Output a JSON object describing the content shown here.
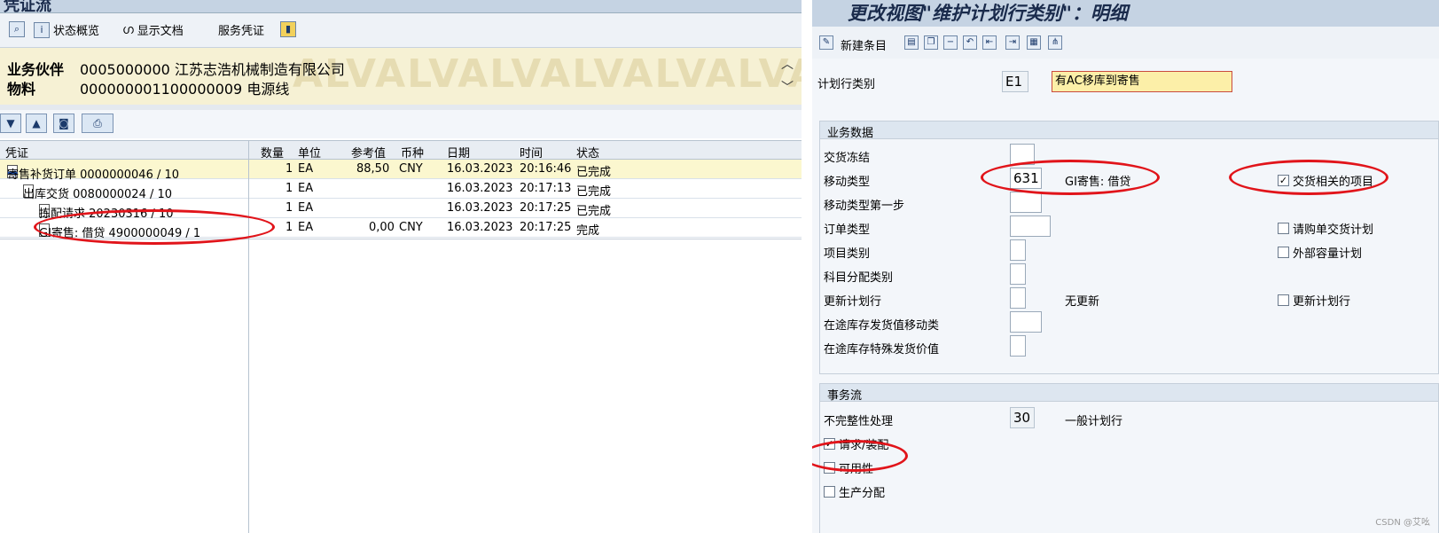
{
  "left": {
    "title": "凭证流",
    "toolbar": {
      "status_overview": "状态概览",
      "display_doc": "显示文档",
      "service_doc": "服务凭证"
    },
    "header": {
      "partner_label": "业务伙伴",
      "partner_value": "0005000000 江苏志浩机械制造有限公司",
      "material_label": "物料",
      "material_value": "000000001100000009 电源线"
    },
    "watermark": "ALVALVALVALVALVALVALV",
    "columns": [
      "凭证",
      "数量",
      "单位",
      "参考值",
      "币种",
      "日期",
      "时间",
      "状态"
    ],
    "rows": [
      {
        "doc": "寄售补货订单 0000000046 / 10",
        "qty": "1",
        "unit": "EA",
        "ref": "88,50",
        "cur": "CNY",
        "date": "16.03.2023",
        "time": "20:16:46",
        "status": "已完成"
      },
      {
        "doc": "出库交货 0080000024 / 10",
        "qty": "1",
        "unit": "EA",
        "ref": "",
        "cur": "",
        "date": "16.03.2023",
        "time": "20:17:13",
        "status": "已完成"
      },
      {
        "doc": "拣配请求 20230316 / 10",
        "qty": "1",
        "unit": "EA",
        "ref": "",
        "cur": "",
        "date": "16.03.2023",
        "time": "20:17:25",
        "status": "已完成"
      },
      {
        "doc": "GI寄售: 借贷 4900000049 / 1",
        "qty": "1",
        "unit": "EA",
        "ref": "0,00",
        "cur": "CNY",
        "date": "16.03.2023",
        "time": "20:17:25",
        "status": "完成"
      }
    ]
  },
  "right": {
    "title": "更改视图\"维护计划行类别\"：明细",
    "toolbar": {
      "new_entries": "新建条目"
    },
    "category_label": "计划行类别",
    "category_code": "E1",
    "category_desc": "有AC移库到寄售",
    "business": {
      "title": "业务数据",
      "delivery_block": "交货冻结",
      "movement_type": "移动类型",
      "movement_type_value": "631",
      "movement_type_desc": "GI寄售: 借贷",
      "movement_type_1step": "移动类型第一步",
      "order_type": "订单类型",
      "item_category": "项目类别",
      "acct_assignment": "科目分配类别",
      "update_sched": "更新计划行",
      "update_sched_desc": "无更新",
      "transit_mvmt": "在途库存发货值移动类",
      "transit_special": "在途库存特殊发货价值",
      "chk_delivery_relevant": "交货相关的项目",
      "chk_purch_req_sched": "请购单交货计划",
      "chk_ext_capacity": "外部容量计划",
      "chk_update_sched": "更新计划行"
    },
    "transaction": {
      "title": "事务流",
      "incompletion": "不完整性处理",
      "incompletion_value": "30",
      "incompletion_desc": "一般计划行",
      "chk_req_assembly": "请求/装配",
      "chk_availability": "可用性",
      "chk_prod_alloc": "生产分配"
    },
    "credit": "CSDN @艾吆"
  }
}
